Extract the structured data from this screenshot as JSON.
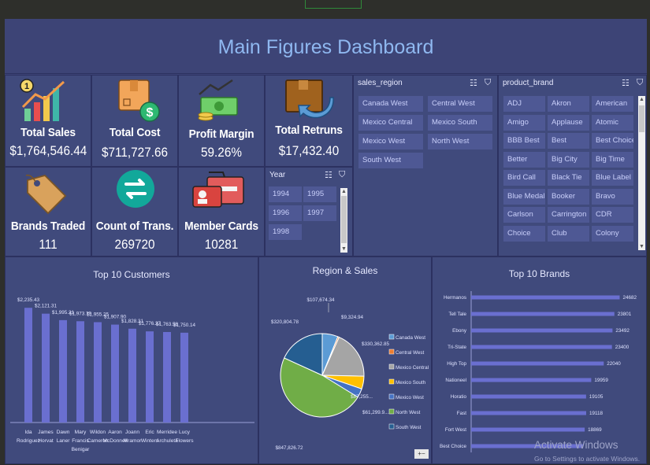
{
  "dashboard": {
    "title": "Main Figures Dashboard"
  },
  "kpis": {
    "total_sales": {
      "label": "Total Sales",
      "value": "$1,764,546.44",
      "badge": "1"
    },
    "total_cost": {
      "label": "Total Cost",
      "value": "$711,727.66"
    },
    "profit_margin": {
      "label": "Profit Margin",
      "value": "59.26%"
    },
    "total_returns": {
      "label": "Total Retruns",
      "value": "$17,432.40"
    },
    "brands_traded": {
      "label": "Brands Traded",
      "value": "111"
    },
    "count_trans": {
      "label": "Count of Trans.",
      "value": "269720"
    },
    "member_cards": {
      "label": "Member Cards",
      "value": "10281"
    }
  },
  "slicers": {
    "sales_region": {
      "header": "sales_region",
      "items": [
        "Canada West",
        "Central West",
        "Mexico Central",
        "Mexico South",
        "Mexico West",
        "North West",
        "South West"
      ]
    },
    "year": {
      "header": "Year",
      "items": [
        "1994",
        "1995",
        "1996",
        "1997",
        "1998"
      ]
    },
    "product_brand": {
      "header": "product_brand",
      "items": [
        "ADJ",
        "Akron",
        "American",
        "Amigo",
        "Applause",
        "Atomic",
        "BBB Best",
        "Best",
        "Best Choice",
        "Better",
        "Big City",
        "Big Time",
        "Bird Call",
        "Black Tie",
        "Blue Label",
        "Blue Medal",
        "Booker",
        "Bravo",
        "Carlson",
        "Carrington",
        "CDR",
        "Choice",
        "Club",
        "Colony"
      ]
    }
  },
  "colors": {
    "dash_bg": "#3d4476",
    "panel_bg": "#404a7c",
    "bar": "#6a6fd0",
    "title": "#8fb8f0"
  },
  "chart_data": [
    {
      "type": "bar",
      "title": "Top 10 Customers",
      "categories": [
        "Ida Rodriguez",
        "James Horvat",
        "Dawn Laner",
        "Mary Francis Benigar",
        "Wildon Cameron",
        "Aaron McDonnell",
        "Joann Mramor",
        "Eric Winters",
        "Merridee Archuleta",
        "Lucy Flowers"
      ],
      "category_lines": [
        [
          "Ida",
          "Rodriguez"
        ],
        [
          "James",
          "Horvat"
        ],
        [
          "Dawn",
          "Laner"
        ],
        [
          "Mary",
          "Francis",
          "Benigar"
        ],
        [
          "Wildon",
          "Cameron"
        ],
        [
          "Aaron",
          "McDonnell"
        ],
        [
          "Joann",
          "Mramor"
        ],
        [
          "Eric",
          "Winters"
        ],
        [
          "Merridee",
          "Archuleta"
        ],
        [
          "Lucy",
          "Flowers"
        ]
      ],
      "values": [
        2235.43,
        2121.31,
        1995.21,
        1973.79,
        1955.25,
        1907.9,
        1828.31,
        1776.27,
        1763.58,
        1750.14
      ],
      "labels": [
        "$2,235.43",
        "$2,121.31",
        "$1,995.21",
        "$1,973.79",
        "$1,955.25",
        "$1,907.90",
        "$1,828.31",
        "$1,776.27",
        "$1,763.58",
        "$1,750.14"
      ]
    },
    {
      "type": "pie",
      "title": "Region & Sales",
      "labels": [
        "Canada West",
        "Central West",
        "Mexico Central",
        "Mexico South",
        "Mexico West",
        "North West",
        "South West"
      ],
      "values": [
        107674.34,
        9324.94,
        330362.85,
        87255.0,
        61299.9,
        847826.72,
        320804.78
      ],
      "value_labels": [
        "$107,674.34",
        "$9,324.94",
        "$330,362.85",
        "$87,255...",
        "$61,299.9...",
        "$847,826.72",
        "$320,804.78"
      ],
      "colors": [
        "#5b9bd5",
        "#ed7d31",
        "#a5a5a5",
        "#ffc000",
        "#4472c4",
        "#70ad47",
        "#255e91"
      ],
      "legend": "right"
    },
    {
      "type": "bar",
      "orientation": "horizontal",
      "title": "Top 10 Brands",
      "categories": [
        "Hermanos",
        "Tell Tale",
        "Ebony",
        "Tri-State",
        "High Top",
        "Nationeel",
        "Horatio",
        "Fast",
        "Fort West",
        "Best Choice"
      ],
      "values": [
        24682,
        23801,
        23492,
        23400,
        22040,
        19959,
        19105,
        19118,
        18869,
        18600
      ],
      "value_labels": [
        "24682",
        "23801",
        "23492",
        "23400",
        "22040",
        "19959",
        "19105",
        "19118",
        "18869",
        ""
      ]
    }
  ],
  "watermark": {
    "line1": "Activate Windows",
    "line2": "Go to Settings to activate Windows."
  }
}
